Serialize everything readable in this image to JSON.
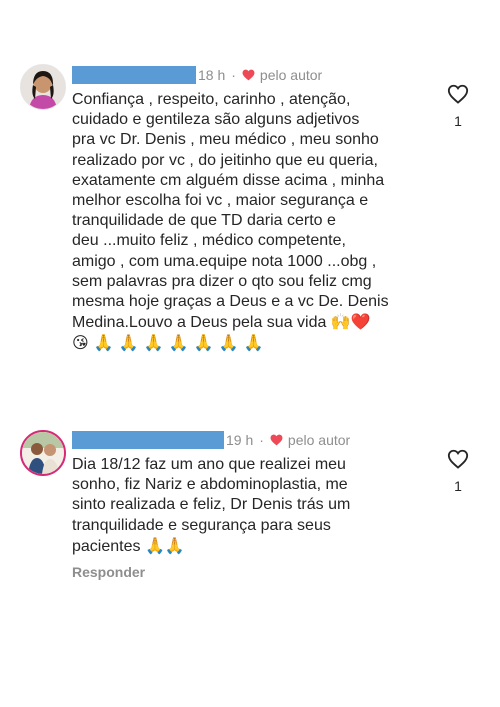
{
  "comments": [
    {
      "time": "18 h",
      "author_badge": "pelo autor",
      "text_lines": [
        "Confiança , respeito, carinho , atenção,",
        "cuidado e gentileza são alguns adjetivos",
        "pra vc Dr. Denis , meu médico , meu sonho",
        "realizado por vc , do jeitinho que eu queria,",
        "exatamente cm alguém disse acima , minha",
        "melhor escolha foi vc , maior segurança e",
        "tranquilidade de que TD daria certo e",
        "deu ...muito feliz , médico competente,",
        "amigo , com uma.equipe nota 1000 ...obg ,",
        "sem palavras pra dizer o qto sou feliz cmg",
        "mesma hoje graças a Deus e a vc De. Denis",
        "Medina.Louvo a Deus pela sua vida"
      ],
      "emoji_after_text": "🙌❤️",
      "emoji_line": "😘 🙏 🙏 🙏 🙏 🙏 🙏 🙏",
      "like_count": "1"
    },
    {
      "time": "19 h",
      "author_badge": "pelo autor",
      "text_lines": [
        "Dia 18/12 faz um ano que realizei meu",
        "sonho, fiz Nariz e abdominoplastia, me",
        "sinto realizada e feliz, Dr Denis trás um",
        "tranquilidade e segurança para seus",
        "pacientes"
      ],
      "emoji_after_text": "🙏🙏",
      "like_count": "1",
      "reply_label": "Responder"
    }
  ],
  "icons": {
    "author_heart": "heart-filled-icon",
    "like": "heart-outline-icon"
  },
  "colors": {
    "author_heart": "#ed4956",
    "redaction": "#5b9bd5",
    "secondary_text": "#8e8e8e"
  }
}
